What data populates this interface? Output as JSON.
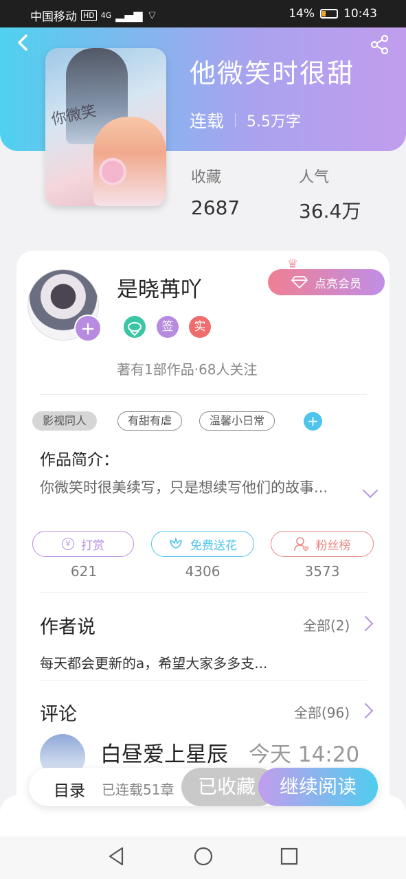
{
  "status_bar": {
    "carrier": "中国移动",
    "hd": "HD",
    "network": "4G",
    "battery_pct": "14%",
    "time": "10:43"
  },
  "book": {
    "title": "他微笑时很甜",
    "status": "连载",
    "word_count": "5.5万字",
    "cover_script": "你微笑",
    "stats": [
      {
        "label": "收藏",
        "value": "2687"
      },
      {
        "label": "人气",
        "value": "36.4万"
      }
    ]
  },
  "author": {
    "name": "是晓苒吖",
    "vip_button": "点亮会员",
    "badges": [
      "签",
      "实"
    ],
    "works_info": "著有1部作品·68人关注"
  },
  "tags": [
    "影视同人",
    "有甜有虐",
    "温馨小日常"
  ],
  "intro": {
    "title": "作品简介：",
    "text": "你微笑时很美续写，只是想续写他们的故事..."
  },
  "actions": [
    {
      "label": "打赏",
      "count": "621",
      "color": "#b98ee0"
    },
    {
      "label": "免费送花",
      "count": "4306",
      "color": "#4fc4ec"
    },
    {
      "label": "粉丝榜",
      "count": "3573",
      "color": "#e98a84"
    }
  ],
  "author_says": {
    "title": "作者说",
    "all_link": "全部(2)",
    "text": "每天都会更新的a，希望大家多多支..."
  },
  "comments": {
    "title": "评论",
    "all_link": "全部(96)",
    "first": {
      "user": "白昼爱上星辰",
      "time": "今天 14:20"
    }
  },
  "bottom_bar": {
    "toc": "目录",
    "serial": "已连载51章",
    "collected": "已收藏",
    "read": "继续阅读"
  }
}
